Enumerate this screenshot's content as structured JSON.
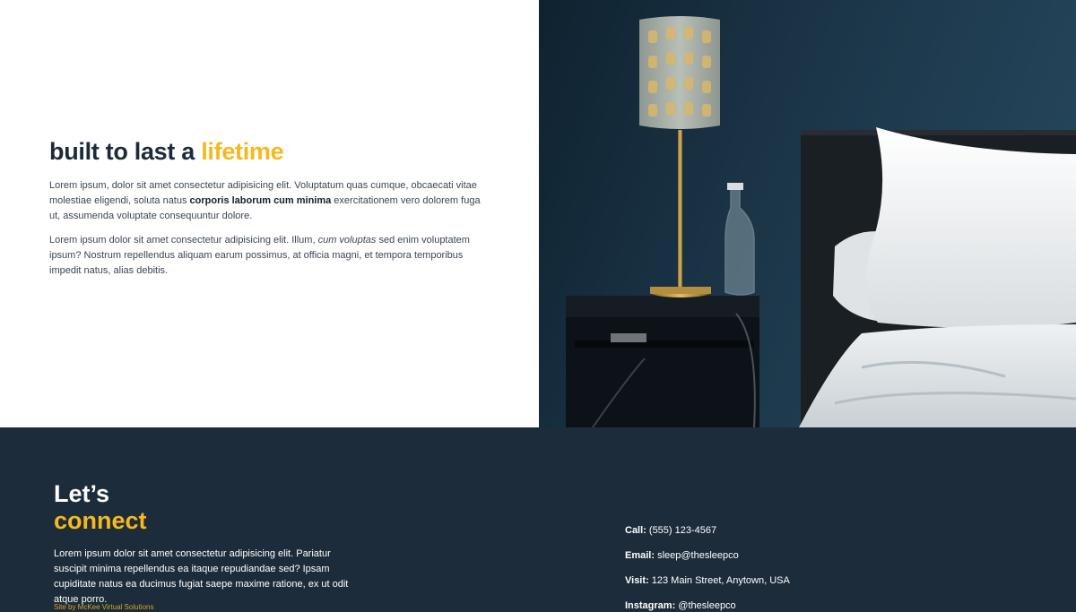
{
  "feature": {
    "heading_main": "built to last a ",
    "heading_accent": "lifetime",
    "para1_a": "Lorem ipsum, dolor sit amet consectetur adipisicing elit. Voluptatum quas cumque, obcaecati vitae molestiae eligendi, soluta natus ",
    "para1_bold": "corporis laborum cum minima",
    "para1_b": " exercitationem vero dolorem fuga ut, assumenda voluptate consequuntur dolore.",
    "para2_a": "Lorem ipsum dolor sit amet consectetur adipisicing elit. Illum, ",
    "para2_italic": "cum voluptas",
    "para2_b": " sed enim voluptatem ipsum? Nostrum repellendus aliquam earum possimus, at officia magni, et tempora temporibus impedit natus, alias debitis."
  },
  "footer": {
    "title_line1": "Let’s",
    "title_line2": "connect",
    "paragraph": "Lorem ipsum dolor sit amet consectetur adipisicing elit. Pariatur suscipit minima repellendus ea itaque repudiandae sed? Ipsam cupiditate natus ea ducimus fugiat saepe maxime ratione, ex ut odit atque porro.",
    "credit": "Site by McKee Virtual Solutions",
    "call_label": "Call:",
    "call_value": " (555) 123-4567",
    "email_label": "Email:",
    "email_value": " sleep@thesleepco",
    "visit_label": "Visit:",
    "visit_value": " 123 Main Street, Anytown, USA",
    "insta_label": "Instagram:",
    "insta_value": " @thesleepco"
  },
  "colors": {
    "accent": "#f7b81e",
    "navy": "#1d2c3a",
    "wall": "#1a3142"
  }
}
